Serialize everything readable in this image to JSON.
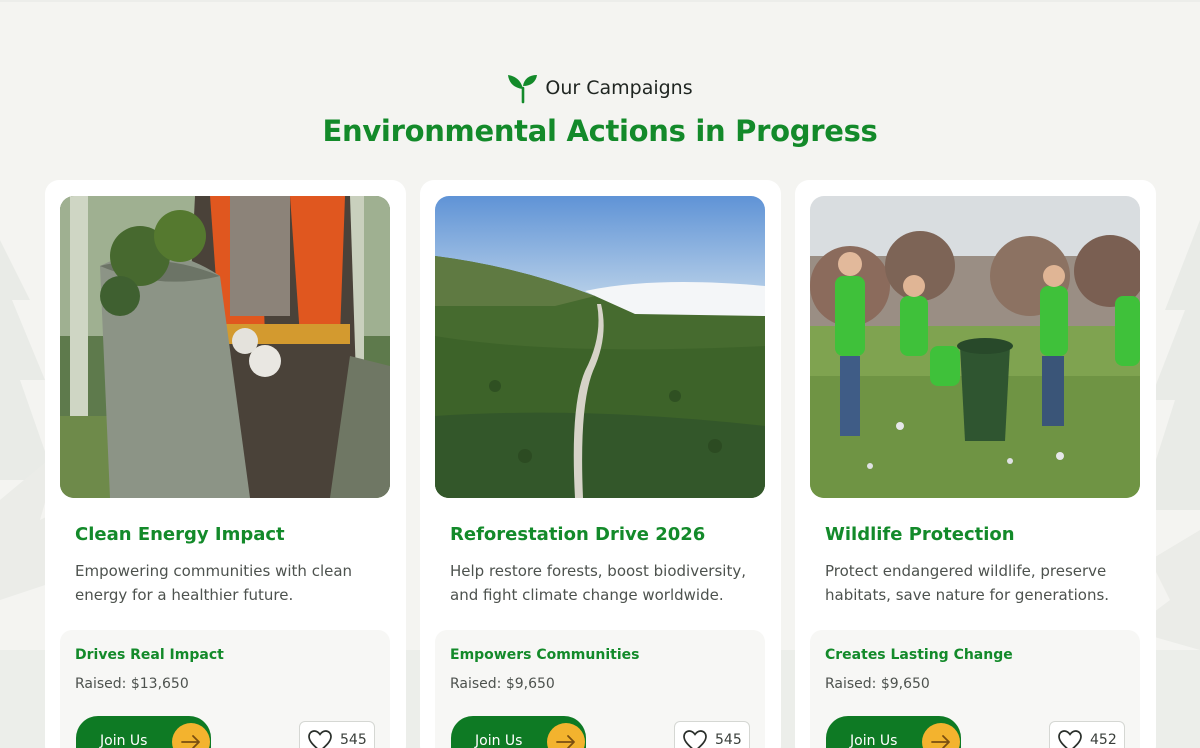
{
  "section": {
    "eyebrow": "Our Campaigns",
    "headline": "Environmental Actions in Progress"
  },
  "theme": {
    "primary_green": "#138a2a",
    "button_green": "#0e7a24",
    "accent_yellow": "#f3b32e",
    "background": "#f4f4f1"
  },
  "icons": {
    "eyebrow": "sprout-icon",
    "join_arrow": "arrow-right-icon",
    "like": "heart-icon"
  },
  "campaigns": [
    {
      "image": "Volunteer in orange safety vest holding a bag of green plants",
      "title": "Clean Energy Impact",
      "description": "Empowering communities with clean energy for a healthier future.",
      "tag": "Drives Real Impact",
      "raised": "Raised: $13,650",
      "button": "Join Us",
      "likes": "545"
    },
    {
      "image": "Aerial view of a road through a dense pine forest above the clouds",
      "title": "Reforestation Drive 2026",
      "description": "Help restore forests, boost biodiversity, and fight climate change worldwide.",
      "tag": "Empowers Communities",
      "raised": "Raised: $9,650",
      "button": "Join Us",
      "likes": "545"
    },
    {
      "image": "Volunteers in green shirts picking up litter in a park",
      "title": "Wildlife Protection",
      "description": "Protect endangered wildlife, preserve habitats, save nature for generations.",
      "tag": "Creates Lasting Change",
      "raised": "Raised: $9,650",
      "button": "Join Us",
      "likes": "452"
    }
  ]
}
